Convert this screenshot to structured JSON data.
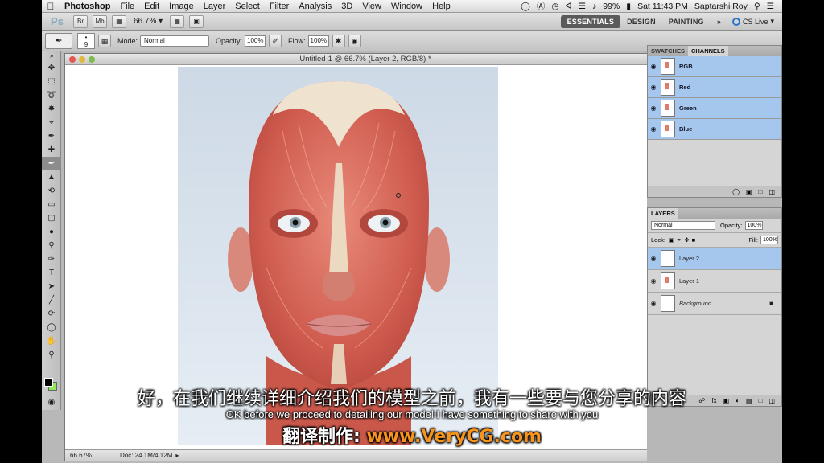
{
  "menubar": {
    "app": "Photoshop",
    "items": [
      "File",
      "Edit",
      "Image",
      "Layer",
      "Select",
      "Filter",
      "Analysis",
      "3D",
      "View",
      "Window",
      "Help"
    ],
    "battery": "99%",
    "clock": "Sat 11:43 PM",
    "user": "Saptarshi Roy"
  },
  "appbar": {
    "logo": "Ps",
    "br_label": "Br",
    "mb_label": "Mb",
    "zoom": "66.7%",
    "workspaces": [
      "ESSENTIALS",
      "DESIGN",
      "PAINTING"
    ],
    "more": "»",
    "cs_live": "CS Live"
  },
  "options": {
    "brush_size": "9",
    "mode_label": "Mode:",
    "mode_value": "Normal",
    "opacity_label": "Opacity:",
    "opacity_value": "100%",
    "flow_label": "Flow:",
    "flow_value": "100%"
  },
  "document": {
    "title": "Untitled-1 @ 66.7% (Layer 2, RGB/8) *",
    "status_zoom": "66.67%",
    "status_doc": "Doc: 24.1M/4.12M"
  },
  "channels_panel": {
    "tabs": [
      "SWATCHES",
      "CHANNELS"
    ],
    "channels": [
      "RGB",
      "Red",
      "Green",
      "Blue"
    ]
  },
  "layers_panel": {
    "tab": "LAYERS",
    "blend_mode": "Normal",
    "opacity_label": "Opacity:",
    "opacity_value": "100%",
    "lock_label": "Lock:",
    "fill_label": "Fill:",
    "fill_value": "100%",
    "layers": [
      "Layer 2",
      "Layer 1",
      "Background"
    ]
  },
  "subtitles": {
    "chinese": "好，在我们继续详细介绍我们的模型之前，我有一些要与您分享的内容",
    "english": "OK before we proceed to detailing our model I have something to share with you",
    "credit_prefix": "翻译制作: ",
    "credit_url": "www.VeryCG.com"
  },
  "colors": {
    "selection_blue": "#a5c7ee",
    "background_swatch": "#8ee85a",
    "credit_orange": "#f7941d"
  }
}
